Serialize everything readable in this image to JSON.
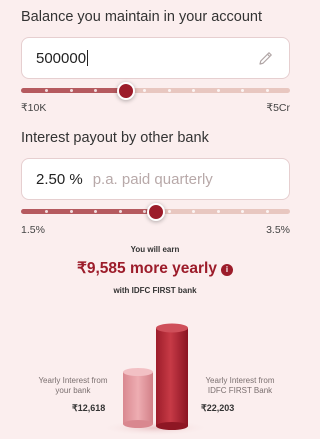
{
  "balance": {
    "label": "Balance you maintain in your account",
    "value": "500000",
    "min_label": "₹10K",
    "max_label": "₹5Cr",
    "slider_fraction": 0.39
  },
  "interest": {
    "label": "Interest payout by other bank",
    "value": "2.50 %",
    "suffix": "p.a. paid quarterly",
    "min_label": "1.5%",
    "max_label": "3.5%",
    "slider_fraction": 0.5
  },
  "earnings": {
    "you_will_earn": "You will earn",
    "amount": "₹9,585 more yearly",
    "with_bank": "with IDFC FIRST bank",
    "info_icon": "i"
  },
  "comparison": {
    "other_bank_label_line1": "Yearly Interest from",
    "other_bank_label_line2": "your bank",
    "other_bank_amount": "₹12,618",
    "idfc_label_line1": "Yearly Interest from",
    "idfc_label_line2": "IDFC FIRST Bank",
    "idfc_amount": "₹22,203"
  },
  "colors": {
    "accent": "#9c1c2a",
    "track_fill": "#b55a5f",
    "track_rest": "#e8c7c0",
    "background": "#fbeeee"
  }
}
